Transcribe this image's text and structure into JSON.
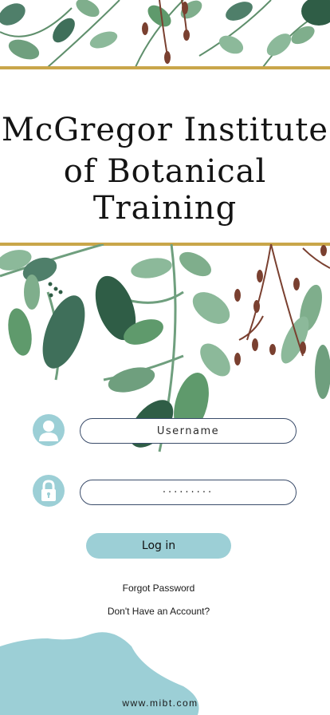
{
  "header": {
    "title_line1": "McGregor Institute",
    "title_line2": "of Botanical Training"
  },
  "login_form": {
    "username_placeholder": "Username",
    "password_value": "·········",
    "login_label": "Log in",
    "forgot_password_label": "Forgot Password",
    "signup_label": "Don't Have an Account?"
  },
  "icons": {
    "username": "user-icon",
    "password": "lock-icon"
  },
  "footer": {
    "url": "www.mibt.com"
  },
  "colors": {
    "accent": "#9ccfd6",
    "gold": "#c9a64a",
    "leaf_dark": "#2f5d46",
    "leaf_mid": "#5f9a6c",
    "leaf_light": "#8cb99a",
    "berry": "#7a4030"
  }
}
